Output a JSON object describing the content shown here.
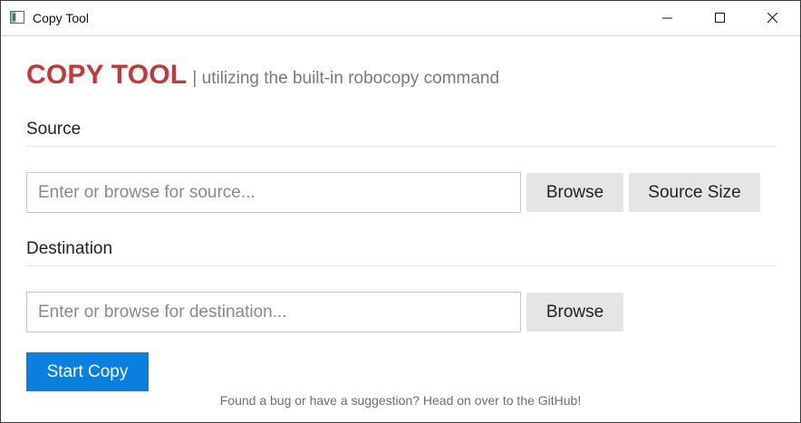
{
  "window": {
    "title": "Copy Tool"
  },
  "header": {
    "brand": "COPY TOOL",
    "tagline": "| utilizing the built-in robocopy command"
  },
  "source": {
    "label": "Source",
    "placeholder": "Enter or browse for source...",
    "value": "",
    "browse_label": "Browse",
    "size_label": "Source Size"
  },
  "destination": {
    "label": "Destination",
    "placeholder": "Enter or browse for destination...",
    "value": "",
    "browse_label": "Browse"
  },
  "actions": {
    "start_label": "Start Copy"
  },
  "footer": {
    "note": "Found a bug or have a suggestion? Head on over to the GitHub!"
  },
  "colors": {
    "brand": "#c0393b",
    "primary": "#0a7fe0",
    "button_gray": "#e5e5e5"
  }
}
